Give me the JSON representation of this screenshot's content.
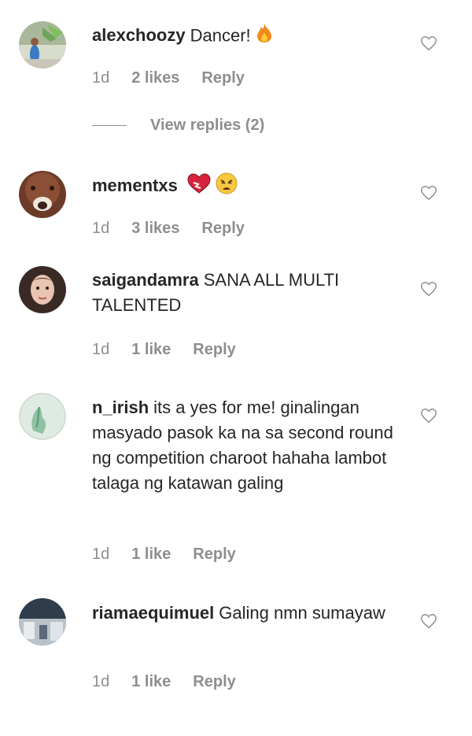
{
  "comments": [
    {
      "username": "alexchoozy",
      "text": "Dancer!",
      "emoji": [
        "fire-emoji"
      ],
      "time": "1d",
      "likes": "2 likes",
      "reply": "Reply",
      "view_replies": "View replies (2)"
    },
    {
      "username": "mementxs",
      "text": "",
      "emoji": [
        "heart-emoji",
        "weary-face-emoji"
      ],
      "time": "1d",
      "likes": "3 likes",
      "reply": "Reply"
    },
    {
      "username": "saigandamra",
      "text": "SANA ALL MULTI TALENTED",
      "time": "1d",
      "likes": "1 like",
      "reply": "Reply"
    },
    {
      "username": "n_irish",
      "text": "its a yes for me! ginalingan masyado pasok ka na sa second round ng competition charoot hahaha lambot talaga ng katawan galing",
      "time": "1d",
      "likes": "1 like",
      "reply": "Reply"
    },
    {
      "username": "riamaequimuel",
      "text": "Galing nmn sumayaw",
      "time": "1d",
      "likes": "1 like",
      "reply": "Reply"
    }
  ],
  "colors": {
    "text": "#262626",
    "muted": "#8e8e8e",
    "heart_outline": "#8e8e8e"
  }
}
